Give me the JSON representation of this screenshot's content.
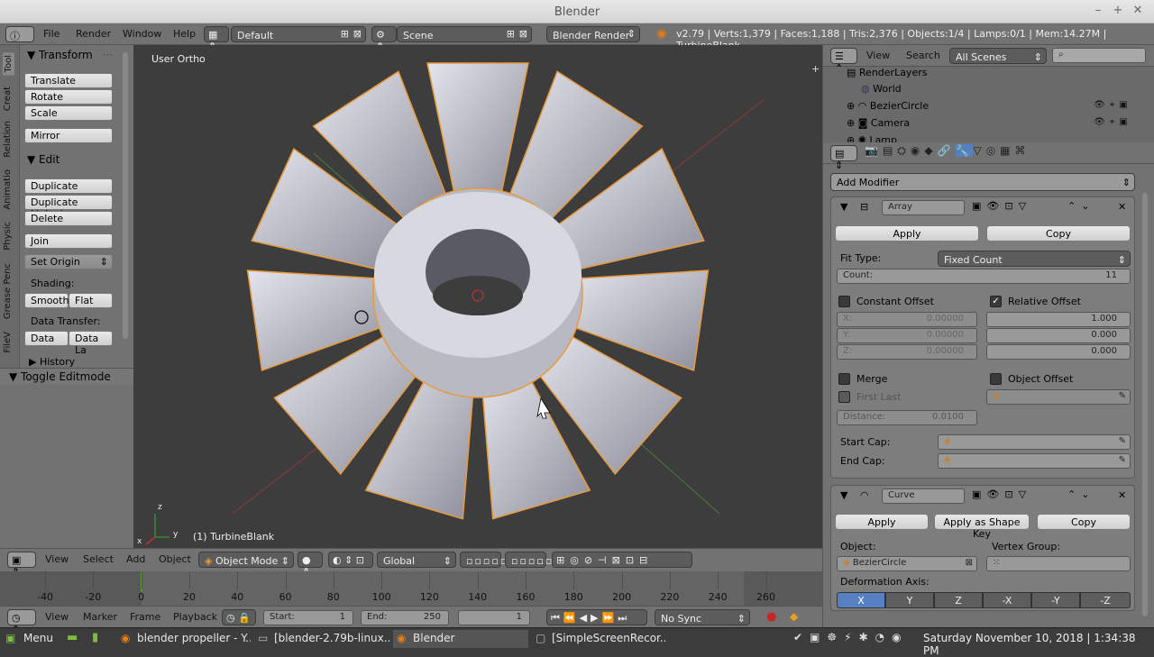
{
  "window": {
    "title": "Blender"
  },
  "info_bar": {
    "menus": [
      "File",
      "Render",
      "Window",
      "Help"
    ],
    "layout": "Default",
    "scene": "Scene",
    "engine": "Blender Render",
    "stats": "v2.79 | Verts:1,379 | Faces:1,188 | Tris:2,376 | Objects:1/4 | Lamps:0/1 | Mem:14.27M | TurbineBlank"
  },
  "tool_shelf": {
    "tabs": [
      "Tool",
      "Creat",
      "Relation",
      "Animatio",
      "Physic",
      "Grease Penc",
      "FileV"
    ],
    "transform_header": "Transform",
    "transform_buttons": [
      "Translate",
      "Rotate",
      "Scale",
      "Mirror"
    ],
    "edit_header": "Edit",
    "edit_buttons": [
      "Duplicate",
      "Duplicate Linked",
      "Delete",
      "Join"
    ],
    "set_origin": "Set Origin",
    "shading_label": "Shading:",
    "shading_buttons": [
      "Smooth",
      "Flat"
    ],
    "data_transfer_label": "Data Transfer:",
    "data_transfer_buttons": [
      "Data",
      "Data La"
    ],
    "history_header": "History",
    "toggle_editmode": "Toggle Editmode"
  },
  "viewport": {
    "view_label": "User Ortho",
    "object_label": "(1) TurbineBlank",
    "axis_x": "x",
    "axis_y": "y",
    "axis_z": "z"
  },
  "viewport_header": {
    "menus": [
      "View",
      "Select",
      "Add",
      "Object"
    ],
    "mode": "Object Mode",
    "orientation": "Global"
  },
  "timeline": {
    "ticks": [
      "-40",
      "-20",
      "0",
      "20",
      "40",
      "60",
      "80",
      "100",
      "120",
      "140",
      "160",
      "180",
      "200",
      "220",
      "240",
      "260"
    ],
    "menus": [
      "View",
      "Marker",
      "Frame",
      "Playback"
    ],
    "start_label": "Start:",
    "start_value": "1",
    "end_label": "End:",
    "end_value": "250",
    "current_frame": "1",
    "sync": "No Sync"
  },
  "outliner": {
    "menus": [
      "View",
      "Search"
    ],
    "filter": "All Scenes",
    "items": [
      "RenderLayers",
      "World",
      "BezierCircle",
      "Camera",
      "Lamp"
    ]
  },
  "properties": {
    "add_modifier": "Add Modifier",
    "array": {
      "name": "Array",
      "apply": "Apply",
      "copy": "Copy",
      "fit_type_label": "Fit Type:",
      "fit_type": "Fixed Count",
      "count_label": "Count:",
      "count": "11",
      "constant_offset": "Constant Offset",
      "relative_offset": "Relative Offset",
      "const_x_label": "X:",
      "const_x": "0.00000",
      "const_y_label": "Y:",
      "const_y": "0.00000",
      "const_z_label": "Z:",
      "const_z": "0.00000",
      "rel_x": "1.000",
      "rel_y": "0.000",
      "rel_z": "0.000",
      "merge": "Merge",
      "object_offset": "Object Offset",
      "first_last": "First Last",
      "distance_label": "Distance:",
      "distance": "0.0100",
      "start_cap": "Start Cap:",
      "end_cap": "End Cap:"
    },
    "curve": {
      "name": "Curve",
      "apply": "Apply",
      "apply_shape_key": "Apply as Shape Key",
      "copy": "Copy",
      "object_label": "Object:",
      "object_value": "BezierCircle",
      "vertex_group_label": "Vertex Group:",
      "deformation_axis_label": "Deformation Axis:",
      "axes": [
        "X",
        "Y",
        "Z",
        "-X",
        "-Y",
        "-Z"
      ]
    }
  },
  "taskbar": {
    "menu": "Menu",
    "tasks": [
      "blender propeller - Y...",
      "[blender-2.79b-linux...",
      "Blender",
      "[SimpleScreenRecor..."
    ],
    "clock": "Saturday November 10, 2018 | 1:34:38 PM"
  }
}
